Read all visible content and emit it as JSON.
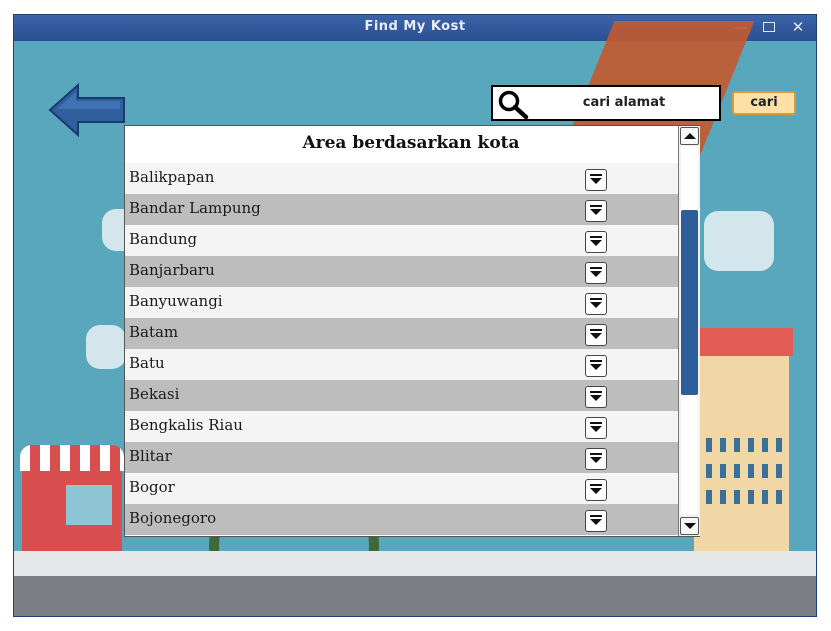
{
  "window": {
    "title": "Find My Kost",
    "min_glyph": "—",
    "close_glyph": "✕"
  },
  "header": {
    "back_button_icon": "back-arrow-icon",
    "search": {
      "value": "cari alamat",
      "icon": "search-icon"
    },
    "search_button_label": "cari"
  },
  "panel": {
    "title": "Area berdasarkan kota",
    "cities": [
      "Balikpapan",
      "Bandar Lampung",
      "Bandung",
      "Banjarbaru",
      "Banyuwangi",
      "Batam",
      "Batu",
      "Bekasi",
      "Bengkalis Riau",
      "Blitar",
      "Bogor",
      "Bojonegoro"
    ],
    "row_action_icon": "dropdown-arrow-icon",
    "scroll_position": 0.35
  },
  "colors": {
    "titlebar": "#2a4f92",
    "background": "#59a7bc",
    "accent_button": "#fde0a6",
    "scroll_thumb": "#2e5e9a",
    "row_alt": "#bdbdbd"
  }
}
